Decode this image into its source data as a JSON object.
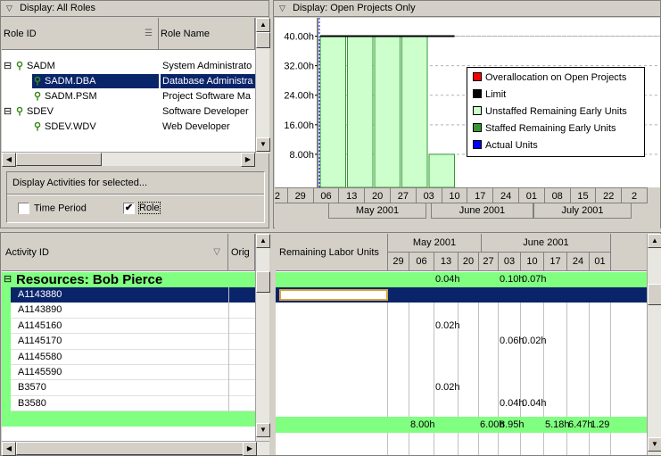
{
  "roles_panel": {
    "title": "Display: All Roles",
    "col_role_id": "Role ID",
    "col_role_name": "Role Name",
    "rows": [
      {
        "id": "SADM",
        "name": "System Administrato",
        "level": 0,
        "expander": "⊟",
        "selected": false
      },
      {
        "id": "SADM.DBA",
        "name": "Database Administra",
        "level": 1,
        "expander": "",
        "selected": true
      },
      {
        "id": "SADM.PSM",
        "name": "Project Software Ma",
        "level": 1,
        "expander": "",
        "selected": false
      },
      {
        "id": "SDEV",
        "name": "Software Developer",
        "level": 0,
        "expander": "⊟",
        "selected": false
      },
      {
        "id": "SDEV.WDV",
        "name": "Web Developer",
        "level": 1,
        "expander": "",
        "selected": false
      }
    ],
    "display_activities_label": "Display Activities for selected...",
    "time_period_label": "Time Period",
    "time_period_checked": false,
    "role_label": "Role",
    "role_checked": true
  },
  "chart_panel": {
    "title": "Display: Open Projects Only"
  },
  "chart_data": {
    "type": "bar",
    "ylim": [
      0,
      44
    ],
    "y_ticks": [
      "40.00h",
      "32.00h",
      "24.00h",
      "16.00h",
      "8.00h"
    ],
    "y_tick_values": [
      40,
      32,
      24,
      16,
      8
    ],
    "weeks": [
      "22",
      "29",
      "06",
      "13",
      "20",
      "27",
      "03",
      "10",
      "17",
      "24",
      "01",
      "08",
      "15",
      "22",
      "2"
    ],
    "months": [
      "May 2001",
      "June 2001",
      "July 2001"
    ],
    "categories": [
      "29",
      "06",
      "13",
      "20",
      "27"
    ],
    "series": [
      {
        "name": "Unstaffed Remaining Early Units",
        "values": [
          40,
          40,
          40,
          40,
          8
        ]
      },
      {
        "name": "Limit",
        "values": [
          40,
          40,
          40,
          40,
          40
        ]
      }
    ],
    "legend": [
      {
        "label": "Overallocation on Open Projects",
        "color": "#ff0000"
      },
      {
        "label": "Limit",
        "color": "#000000"
      },
      {
        "label": "Unstaffed Remaining Early Units",
        "color": "#ccffcc"
      },
      {
        "label": "Staffed Remaining Early Units",
        "color": "#339933"
      },
      {
        "label": "Actual Units",
        "color": "#0000ff"
      }
    ],
    "legend_position": "right"
  },
  "activity_panel": {
    "col_activity_id": "Activity ID",
    "col_orig": "Orig",
    "col_remaining": "Remaining Labor Units",
    "months": [
      "May 2001",
      "June 2001"
    ],
    "weeks": [
      "29",
      "06",
      "13",
      "20",
      "27",
      "03",
      "10",
      "17",
      "24",
      "01"
    ],
    "group_label": "Resources: Bob Pierce",
    "group_values": [
      "",
      "",
      "0.04h",
      "",
      "",
      "0.10h",
      "0.07h",
      "",
      "",
      ""
    ],
    "activities": [
      {
        "id": "A1143880",
        "values": [
          "",
          "",
          "",
          "",
          "",
          "",
          "",
          "",
          "",
          ""
        ],
        "selected": true
      },
      {
        "id": "A1143890",
        "values": [
          "",
          "",
          "",
          "",
          "",
          "",
          "",
          "",
          "",
          ""
        ],
        "selected": false
      },
      {
        "id": "A1145160",
        "values": [
          "",
          "",
          "0.02h",
          "",
          "",
          "",
          "",
          "",
          "",
          ""
        ],
        "selected": false
      },
      {
        "id": "A1145170",
        "values": [
          "",
          "",
          "",
          "",
          "",
          "0.06h",
          "0.02h",
          "",
          "",
          ""
        ],
        "selected": false
      },
      {
        "id": "A1145580",
        "values": [
          "",
          "",
          "",
          "",
          "",
          "",
          "",
          "",
          "",
          ""
        ],
        "selected": false
      },
      {
        "id": "A1145590",
        "values": [
          "",
          "",
          "",
          "",
          "",
          "",
          "",
          "",
          "",
          ""
        ],
        "selected": false
      },
      {
        "id": "B3570",
        "values": [
          "",
          "",
          "0.02h",
          "",
          "",
          "",
          "",
          "",
          "",
          ""
        ],
        "selected": false
      },
      {
        "id": "B3580",
        "values": [
          "",
          "",
          "",
          "",
          "",
          "0.04h",
          "0.04h",
          "",
          "",
          ""
        ],
        "selected": false
      }
    ],
    "total_values": [
      "",
      "8.00h",
      "",
      "",
      "6.00h",
      "8.95h",
      "",
      "5.18h",
      "6.47h",
      "1.29"
    ]
  },
  "colors": {
    "selection": "#0a246a",
    "group_green": "#80ff80",
    "bar_fill": "#ccffcc"
  }
}
